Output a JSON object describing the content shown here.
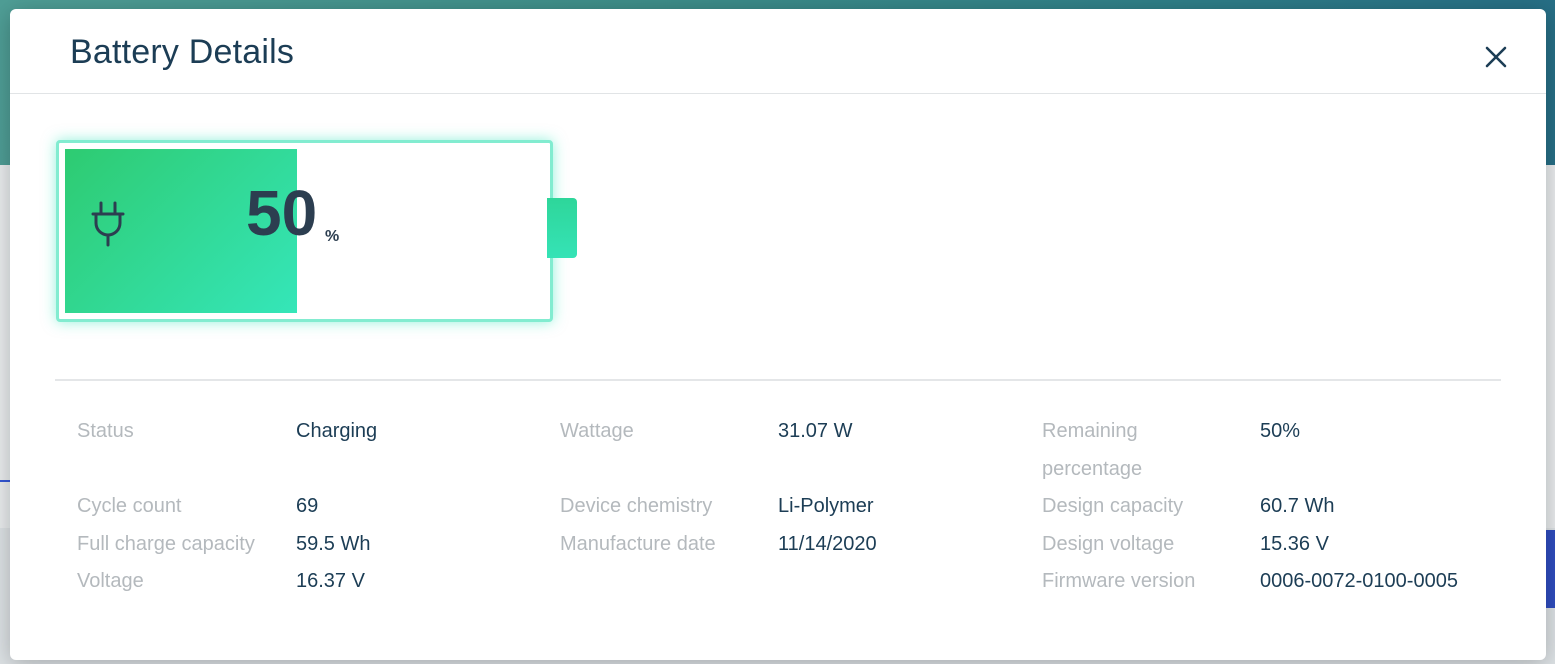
{
  "modal": {
    "title": "Battery Details",
    "close_icon": "close-icon"
  },
  "battery": {
    "percent_text": "50",
    "percent_sign": "%",
    "level": 0.5,
    "icon": "plug-icon",
    "fill_color_start": "#2ecb71",
    "fill_color_end": "#35e6b9"
  },
  "details": {
    "status_label": "Status",
    "status_value": "Charging",
    "cycle_count_label": "Cycle count",
    "cycle_count_value": "69",
    "full_charge_label": "Full charge capacity",
    "full_charge_value": "59.5 Wh",
    "voltage_label": "Voltage",
    "voltage_value": "16.37 V",
    "wattage_label": "Wattage",
    "wattage_value": "31.07 W",
    "chemistry_label": "Device chemistry",
    "chemistry_value": "Li-Polymer",
    "manufacture_label": "Manufacture date",
    "manufacture_value": "11/14/2020",
    "remaining_label_line1": "Remaining",
    "remaining_label_line2": "percentage",
    "remaining_value": "50%",
    "design_capacity_label": "Design capacity",
    "design_capacity_value": "60.7 Wh",
    "design_voltage_label": "Design voltage",
    "design_voltage_value": "15.36 V",
    "firmware_label": "Firmware version",
    "firmware_value": "0006-0072-0100-0005"
  }
}
